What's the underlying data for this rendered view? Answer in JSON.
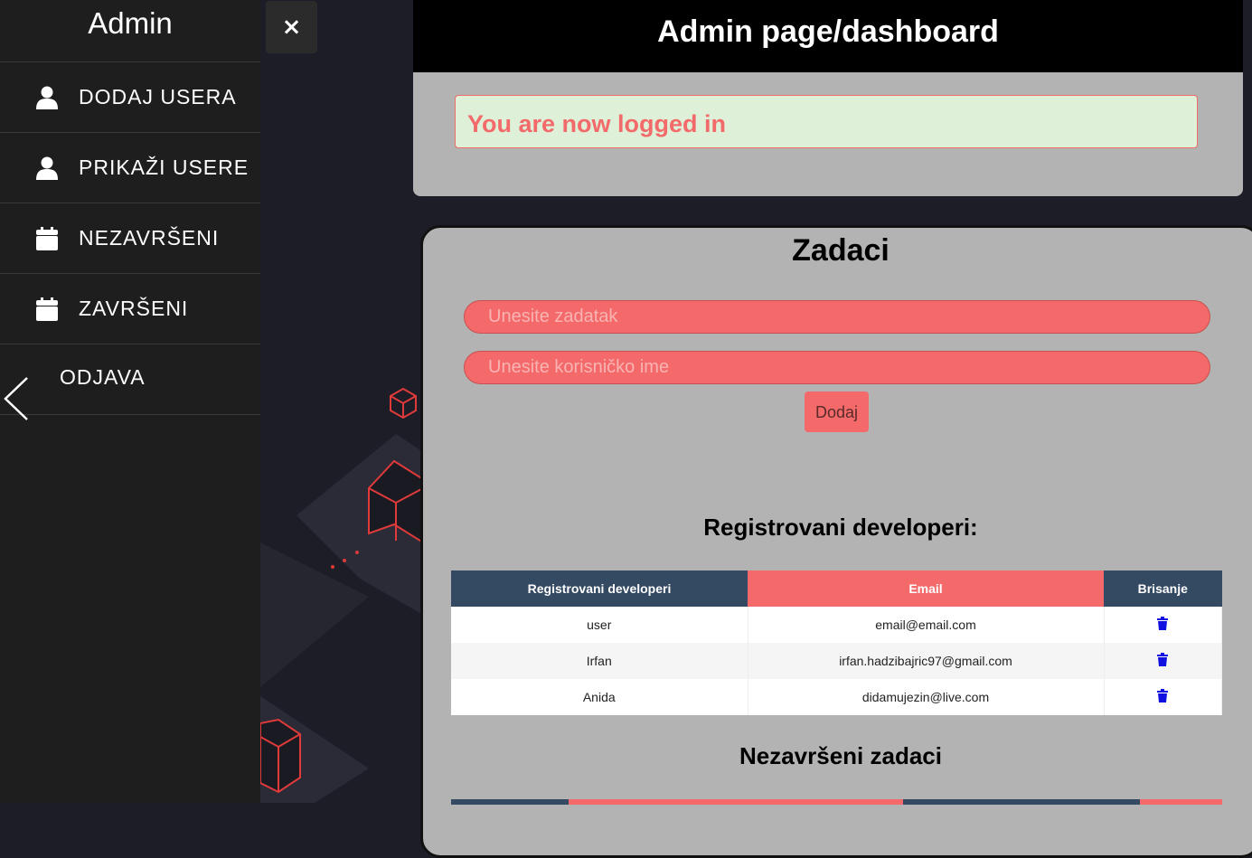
{
  "sidebar": {
    "title": "Admin",
    "items": [
      {
        "label": "DODAJ USERA",
        "icon": "user-icon"
      },
      {
        "label": "PRIKAŽI USERE",
        "icon": "user-icon"
      },
      {
        "label": "NEZAVRŠENI",
        "icon": "calendar-icon"
      },
      {
        "label": "ZAVRŠENI",
        "icon": "calendar-icon"
      },
      {
        "label": "ODJAVA",
        "icon": "chevron-left-icon"
      }
    ]
  },
  "close_button": {
    "label": "×"
  },
  "header": {
    "title": "Admin page/dashboard"
  },
  "alert": {
    "message": "You are now logged in"
  },
  "tasks": {
    "title": "Zadaci",
    "task_placeholder": "Unesite zadatak",
    "username_placeholder": "Unesite korisničko ime",
    "add_label": "Dodaj"
  },
  "developers": {
    "heading": "Registrovani developeri:",
    "columns": [
      "Registrovani developeri",
      "Email",
      "Brisanje"
    ],
    "rows": [
      {
        "name": "user",
        "email": "email@email.com"
      },
      {
        "name": "Irfan",
        "email": "irfan.hadzibajric97@gmail.com"
      },
      {
        "name": "Anida",
        "email": "didamujezin@live.com"
      }
    ]
  },
  "unfinished": {
    "heading": "Nezavršeni zadaci"
  },
  "colors": {
    "accent": "#f46a6a",
    "table_header": "#344a63",
    "sidebar": "#1e1e1e",
    "alert_bg": "#dff0d8",
    "trash": "#1010e0"
  }
}
